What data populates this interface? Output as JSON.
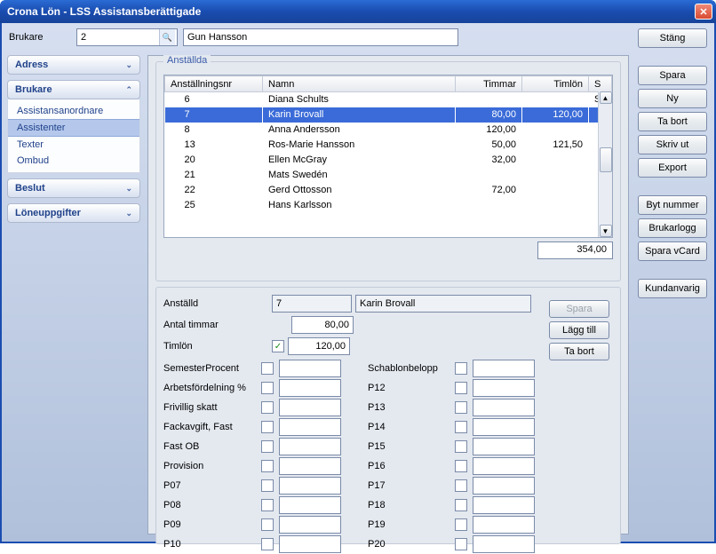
{
  "window": {
    "title": "Crona Lön - LSS Assistansberättigade"
  },
  "topbar": {
    "brukare_label": "Brukare",
    "brukare_id": "2",
    "brukare_name": "Gun Hansson"
  },
  "buttons": {
    "stang": "Stäng",
    "spara": "Spara",
    "ny": "Ny",
    "tabort": "Ta bort",
    "skrivut": "Skriv ut",
    "export": "Export",
    "bytnummer": "Byt nummer",
    "brukarlogg": "Brukarlogg",
    "sparavcard": "Spara vCard",
    "kundanvarig": "Kundanvarig"
  },
  "nav": {
    "adress": "Adress",
    "brukare": "Brukare",
    "brukare_items": [
      "Assistansanordnare",
      "Assistenter",
      "Texter",
      "Ombud"
    ],
    "brukare_selected_index": 1,
    "beslut": "Beslut",
    "loneuppgifter": "Löneuppgifter"
  },
  "grid": {
    "title": "Anställda",
    "columns": [
      "Anställningsnr",
      "Namn",
      "Timmar",
      "Timlön",
      "S"
    ],
    "rows": [
      {
        "nr": "6",
        "namn": "Diana Schults",
        "timmar": "",
        "timlon": "",
        "s": "S"
      },
      {
        "nr": "7",
        "namn": "Karin Brovall",
        "timmar": "80,00",
        "timlon": "120,00",
        "s": ""
      },
      {
        "nr": "8",
        "namn": "Anna Andersson",
        "timmar": "120,00",
        "timlon": "",
        "s": ""
      },
      {
        "nr": "13",
        "namn": "Ros-Marie Hansson",
        "timmar": "50,00",
        "timlon": "121,50",
        "s": ""
      },
      {
        "nr": "20",
        "namn": "Ellen McGray",
        "timmar": "32,00",
        "timlon": "",
        "s": ""
      },
      {
        "nr": "21",
        "namn": "Mats Swedén",
        "timmar": "",
        "timlon": "",
        "s": ""
      },
      {
        "nr": "22",
        "namn": "Gerd Ottosson",
        "timmar": "72,00",
        "timlon": "",
        "s": ""
      },
      {
        "nr": "25",
        "namn": "Hans Karlsson",
        "timmar": "",
        "timlon": "",
        "s": ""
      }
    ],
    "selected_index": 1,
    "total": "354,00"
  },
  "detail": {
    "anstalld_label": "Anställd",
    "anstalld_nr": "7",
    "anstalld_namn": "Karin Brovall",
    "antal_timmar_label": "Antal timmar",
    "antal_timmar": "80,00",
    "timlon_label": "Timlön",
    "timlon_checked": true,
    "timlon": "120,00",
    "spara": "Spara",
    "laggtill": "Lägg till",
    "tabort": "Ta bort",
    "left_params": [
      "SemesterProcent",
      "Arbetsfördelning %",
      "Frivillig skatt",
      "Fackavgift, Fast",
      "Fast OB",
      "Provision",
      "P07",
      "P08",
      "P09",
      "P10"
    ],
    "right_params": [
      "Schablonbelopp",
      "P12",
      "P13",
      "P14",
      "P15",
      "P16",
      "P17",
      "P18",
      "P19",
      "P20"
    ]
  }
}
